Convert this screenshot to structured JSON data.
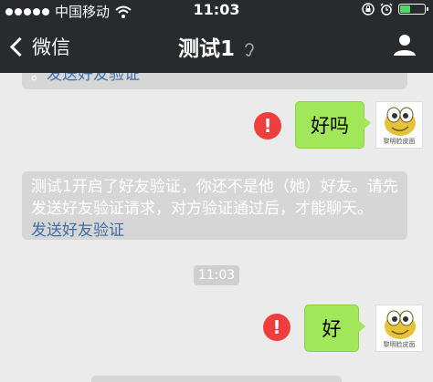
{
  "status_bar": {
    "carrier": "中国移动",
    "time": "11:03",
    "battery_level": 0.45
  },
  "nav": {
    "back_label": "微信",
    "title": "测试1"
  },
  "messages": {
    "system_top_link": "发送好友验证",
    "sent_1": "好吗",
    "system_mid_text": "测试1开启了好友验证，你还不是他（她）好友。请先发送好友验证请求，对方验证通过后，才能聊天。",
    "system_mid_link": "发送好友验证",
    "timestamp": "11:03",
    "sent_2": "好",
    "avatar_caption": "黎明脸皮面"
  },
  "colors": {
    "header_bg": "#292a2e",
    "chat_bg": "#ebebeb",
    "bubble_green": "#a0e75a",
    "error_red": "#f03e3e",
    "link_blue": "#3f6ea6"
  }
}
